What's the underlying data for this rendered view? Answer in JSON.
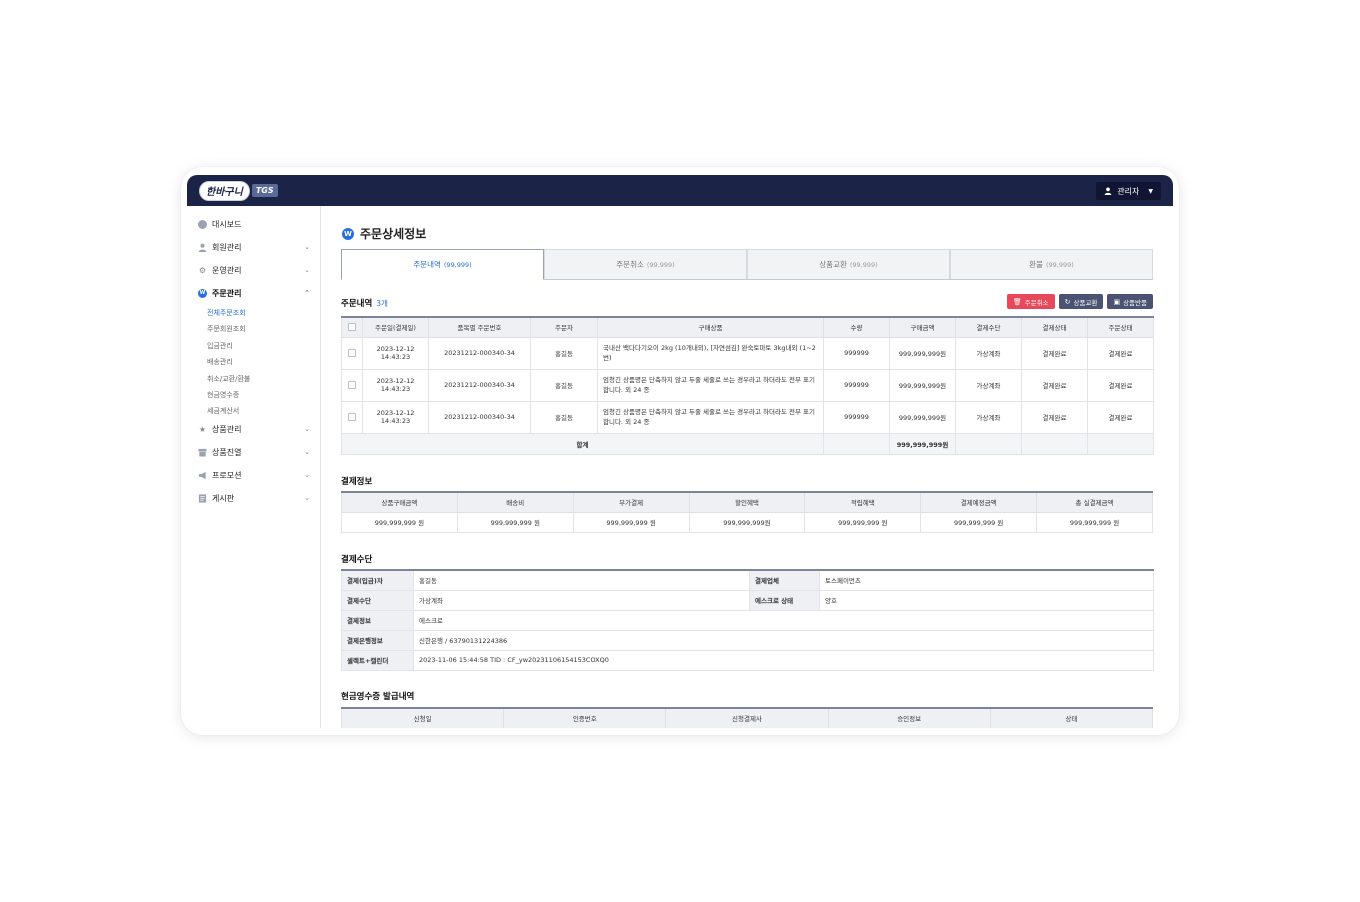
{
  "header": {
    "logo_text": "한바구니",
    "logo_sub": "TGS",
    "user_label": "관리자"
  },
  "sidebar": {
    "items": [
      {
        "label": "대시보드",
        "icon": "dashboard-icon"
      },
      {
        "label": "회원관리",
        "icon": "user-icon"
      },
      {
        "label": "운영관리",
        "icon": "gear-icon"
      },
      {
        "label": "주문관리",
        "icon": "order-icon"
      },
      {
        "label": "상품관리",
        "icon": "star-icon"
      },
      {
        "label": "상품진열",
        "icon": "store-icon"
      },
      {
        "label": "프로모션",
        "icon": "megaphone-icon"
      },
      {
        "label": "게시판",
        "icon": "board-icon"
      }
    ],
    "sub_items": [
      "전체주문조회",
      "주문회원조회",
      "입금관리",
      "배송관리",
      "취소/교환/환불",
      "현금영수증",
      "세금계산서"
    ]
  },
  "page": {
    "title": "주문상세정보"
  },
  "tabs": [
    {
      "label": "주문내역",
      "count": "(99,999)"
    },
    {
      "label": "주문취소",
      "count": "(99,999)"
    },
    {
      "label": "상품교환",
      "count": "(99,999)"
    },
    {
      "label": "환불",
      "count": "(99,999)"
    }
  ],
  "orders": {
    "title": "주문내역",
    "count": "3개",
    "buttons": {
      "cancel": "주문취소",
      "exchange": "상품교환",
      "return": "상품반품"
    },
    "columns": [
      "주문일(결제일)",
      "품목별 주문번호",
      "주문자",
      "구매상품",
      "수량",
      "구매금액",
      "결제수단",
      "결제상태",
      "주문상태"
    ],
    "rows": [
      {
        "date1": "2023-12-12",
        "date2": "14:43:23",
        "order_no": "20231212-000340-34",
        "buyer": "홍길동",
        "product": "국내산 백다다기오이 2kg (10개내외), [자연섬김] 완숙토마토 3kg내외 (1~2번)",
        "qty": "999999",
        "amount": "999,999,999원",
        "method": "가상계좌",
        "pay_status": "결제완료",
        "order_status": "결제완료"
      },
      {
        "date1": "2023-12-12",
        "date2": "14:43:23",
        "order_no": "20231212-000340-34",
        "buyer": "홍길동",
        "product": "엄청긴 상품명은 단축하지 않고 두줄 세줄로 쓰는 경우라고 하더라도 전부 표기 합니다. 외 24 종",
        "qty": "999999",
        "amount": "999,999,999원",
        "method": "가상계좌",
        "pay_status": "결제완료",
        "order_status": "결제완료"
      },
      {
        "date1": "2023-12-12",
        "date2": "14:43:23",
        "order_no": "20231212-000340-34",
        "buyer": "홍길동",
        "product": "엄청긴 상품명은 단축하지 않고 두줄 세줄로 쓰는 경우라고 하더라도 전부 표기 합니다. 외 24 종",
        "qty": "999999",
        "amount": "999,999,999원",
        "method": "가상계좌",
        "pay_status": "결제완료",
        "order_status": "결제완료"
      }
    ],
    "total_label": "합계",
    "total_amount": "999,999,999원"
  },
  "payment_info": {
    "title": "결제정보",
    "columns": [
      "상품구매금액",
      "배송비",
      "부가결제",
      "할인혜택",
      "적립혜택",
      "결제예정금액",
      "총 실결제금액"
    ],
    "values": [
      "999,999,999 원",
      "999,999,999 원",
      "999,999,999 원",
      "999,999,999원",
      "999,999,999 원",
      "999,999,999 원",
      "999,999,999 원"
    ]
  },
  "payment_method": {
    "title": "결제수단",
    "rows": [
      {
        "label": "결제(입금)자",
        "value": "홍길동",
        "label2": "결제업체",
        "value2": "토스페이먼츠"
      },
      {
        "label": "결제수단",
        "value": "가상계좌",
        "label2": "에스크로 상태",
        "value2": "양호"
      },
      {
        "label": "결제정보",
        "value": "에스크로"
      },
      {
        "label": "결제은행정보",
        "value": "신한은행 / 63790131224386"
      },
      {
        "label": "셀렉트+캘린더",
        "value": "2023-11-06 15:44:58 TID : CF_yw20231106154153COXQ0"
      }
    ]
  },
  "receipt": {
    "title": "현금영수증 발급내역",
    "columns": [
      "신청일",
      "인증번호",
      "신청결제사",
      "승인정보",
      "상태"
    ]
  }
}
